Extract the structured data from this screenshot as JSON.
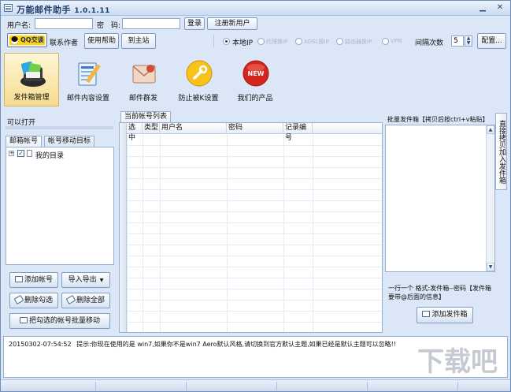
{
  "window": {
    "title": "万能邮件助手",
    "version": "1.0.1.11",
    "minimize": "▁",
    "close": "✕"
  },
  "login": {
    "username_label": "用户名:",
    "username_value": "",
    "password_label": "密　码:",
    "password_value": "",
    "login_button": "登录",
    "register_button": "注册新用户"
  },
  "toolbar": {
    "qq_button": "QQ交谈",
    "contact_author": "联系作者",
    "help": "使用帮助",
    "home": "到主站",
    "ip_options": [
      "本地IP",
      "代理换IP",
      "ADSL换IP",
      "路由器换IP",
      "VPN"
    ],
    "selected_ip": "本地IP",
    "interval_label": "间隔次数",
    "interval_value": "5",
    "config_button": "配置..."
  },
  "modules": [
    {
      "label": "发件箱管理",
      "icon": "mailbox-icon",
      "active": true
    },
    {
      "label": "邮件内容设置",
      "icon": "edit-document-icon",
      "active": false
    },
    {
      "label": "邮件群发",
      "icon": "envelope-icon",
      "active": false
    },
    {
      "label": "防止被K设置",
      "icon": "wrench-icon",
      "active": false
    },
    {
      "label": "我们的产品",
      "icon": "new-badge-icon",
      "active": false
    }
  ],
  "left_panel": {
    "header": "可以打开",
    "tabs": [
      "邮箱帐号",
      "帐号移动目标"
    ],
    "tree_root": "我的目录",
    "buttons": {
      "add_account": "添加帐号",
      "import_export": "导入导出",
      "delete_checked": "删除勾选",
      "delete_all": "删除全部",
      "batch_move": "把勾选的帐号批量移动"
    }
  },
  "center_panel": {
    "tab": "当前帐号列表",
    "columns": [
      "选中",
      "类型",
      "用户名",
      "密码",
      "记录编号"
    ]
  },
  "right_panel": {
    "header": "批量发件箱【拷贝后按ctrl+v粘贴】",
    "vertical_tab": "直接拷贝加入发件箱",
    "hint": "一行一个 格式:发件箱--密码【发件箱要带@后面的信息】",
    "add_button": "添加发件箱"
  },
  "log": {
    "timestamp": "20150302-07:54:52",
    "message": "提示:你现在使用的是 win7,如果你不是win7 Aero默认风格,请切换到官方默认主题,如果已经是默认主题可以忽略!!"
  },
  "watermark_text": "下载吧"
}
